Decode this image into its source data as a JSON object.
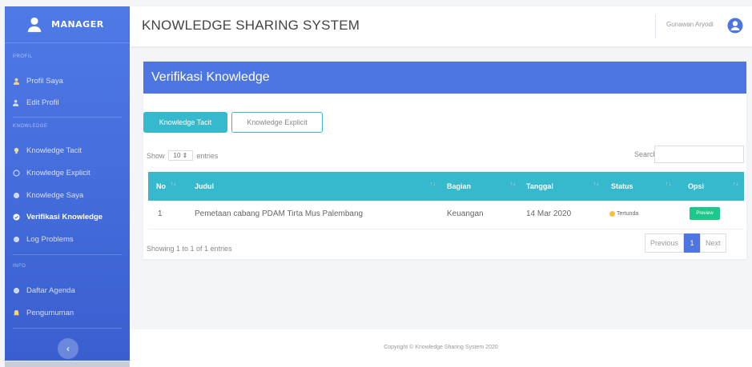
{
  "app": {
    "brand": "MANAGER",
    "title": "KNOWLEDGE SHARING SYSTEM",
    "user_name": "Gunawan Aryodi"
  },
  "sidebar": {
    "sections": [
      {
        "heading": "Profil",
        "items": [
          {
            "label": "Profil Saya",
            "icon": "user-icon",
            "active": false
          },
          {
            "label": "Edit Profil",
            "icon": "user-edit-icon",
            "active": false
          }
        ]
      },
      {
        "heading": "Knowledge",
        "items": [
          {
            "label": "Knowledge Tacit",
            "icon": "lightbulb-icon",
            "active": false
          },
          {
            "label": "Knowledge Explicit",
            "icon": "circle-icon",
            "active": false
          },
          {
            "label": "Knowledge Saya",
            "icon": "circle-icon",
            "active": false
          },
          {
            "label": "Verifikasi Knowledge",
            "icon": "check-circle-icon",
            "active": true
          },
          {
            "label": "Log Problems",
            "icon": "circle-icon",
            "active": false
          }
        ]
      },
      {
        "heading": "Info",
        "items": [
          {
            "label": "Daftar Agenda",
            "icon": "calendar-icon",
            "active": false
          },
          {
            "label": "Pengumuman",
            "icon": "bell-icon",
            "active": false
          }
        ]
      }
    ],
    "toggle_icon": "chevron-left-icon"
  },
  "card": {
    "title": "Verifikasi Knowledge",
    "tabs": {
      "tacit": "Knowledge Tacit",
      "explicit": "Knowledge Explicit"
    },
    "show_prefix": "Show",
    "show_value": "10",
    "show_suffix": "entries",
    "search_label": "Search:",
    "columns": [
      "No",
      "Judul",
      "Bagian",
      "Tanggal",
      "Status",
      "Opsi"
    ],
    "rows": [
      {
        "no": "1",
        "judul": "Pemetaan cabang PDAM Tirta Mus Palembang",
        "bagian": "Keuangan",
        "tanggal": "14 Mar 2020",
        "status": "Tertunda",
        "opsi": "Preview"
      }
    ],
    "showing": "Showing 1 to 1 of 1 entries",
    "pager": {
      "prev": "Previous",
      "page": "1",
      "next": "Next"
    }
  },
  "footer": {
    "text": "Copyright © Knowledge Sharing System 2020"
  },
  "colors": {
    "primary": "#4e76e3",
    "info": "#36b9cc",
    "success": "#1cc88a",
    "warning": "#f6c23e"
  }
}
